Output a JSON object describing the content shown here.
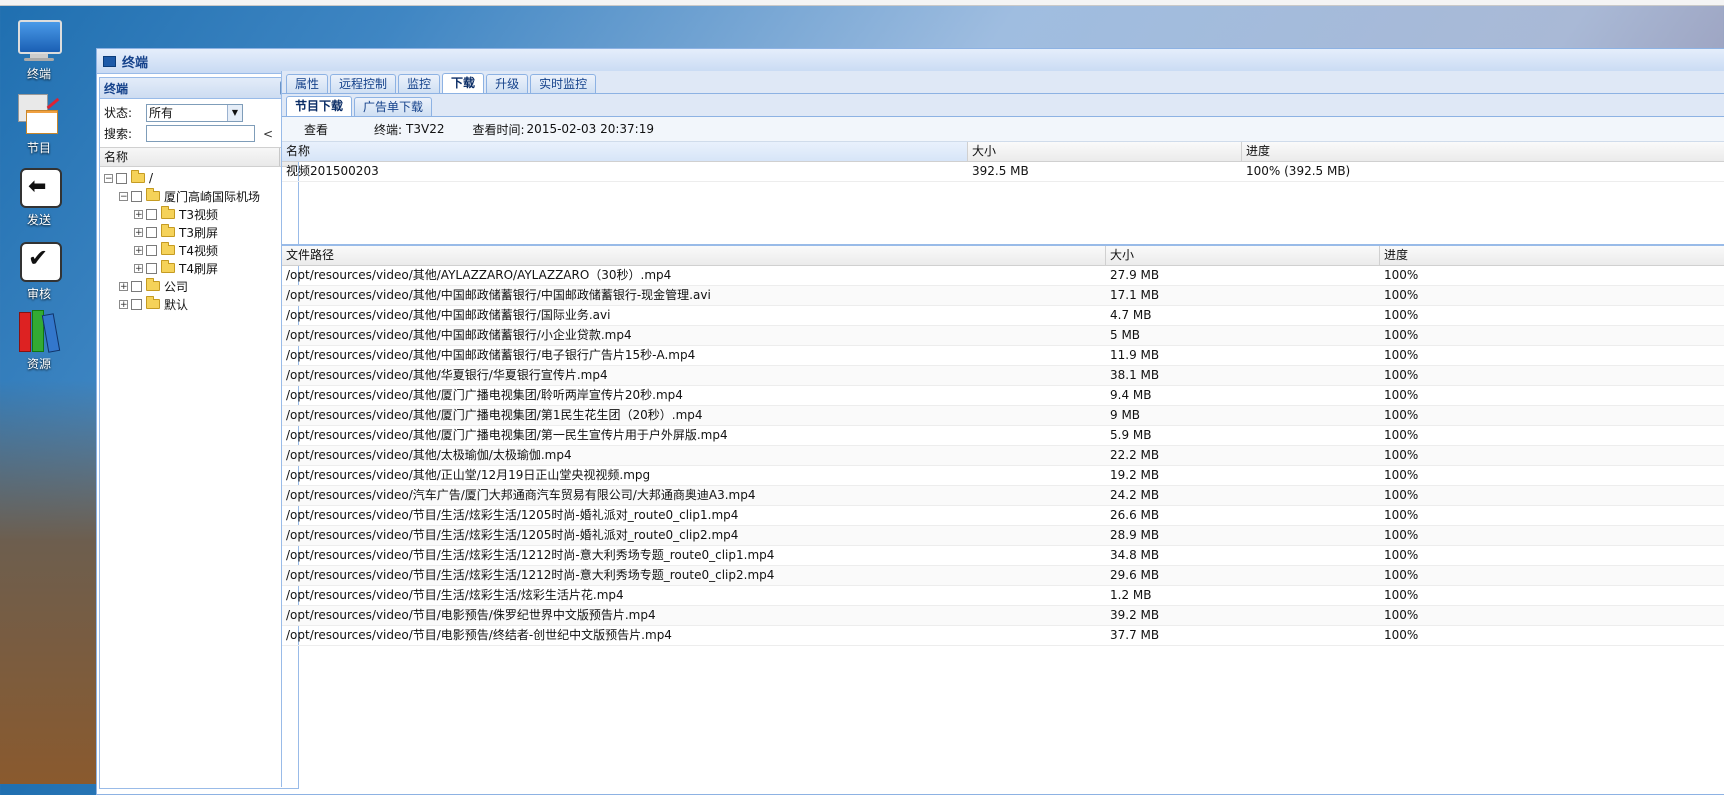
{
  "desktop": {
    "icons": [
      {
        "label": "终端"
      },
      {
        "label": "节目"
      },
      {
        "label": "发送"
      },
      {
        "label": "审核"
      },
      {
        "label": "资源"
      }
    ]
  },
  "window": {
    "title": "终端"
  },
  "left_panel": {
    "title": "终端",
    "status_label": "状态:",
    "status_value": "所有",
    "search_label": "搜索:",
    "search_value": "",
    "prev": "<",
    "next": ">",
    "tree_header": "名称",
    "tree": {
      "root": "/",
      "airport": "厦门高崎国际机场",
      "t3_video": "T3视频",
      "t3_flush": "T3刷屏",
      "t4_video": "T4视频",
      "t4_flush": "T4刷屏",
      "company": "公司",
      "default": "默认"
    }
  },
  "tabs": [
    "属性",
    "远程控制",
    "监控",
    "下载",
    "升级",
    "实时监控"
  ],
  "active_tab": "下载",
  "subtabs": [
    "节目下载",
    "广告单下载"
  ],
  "toolbar": {
    "view": "查看",
    "terminal_label": "终端:",
    "terminal_value": "T3V22",
    "time_label": "查看时间:",
    "time_value": "2015-02-03 20:37:19"
  },
  "top_grid": {
    "columns": [
      "名称",
      "大小",
      "进度"
    ],
    "rows": [
      [
        "视频201500203",
        "392.5 MB",
        "100% (392.5 MB)"
      ]
    ]
  },
  "bottom_grid": {
    "columns": [
      "文件路径",
      "大小",
      "进度"
    ],
    "rows": [
      [
        "/opt/resources/video/其他/AYLAZZARO/AYLAZZARO（30秒）.mp4",
        "27.9 MB",
        "100%"
      ],
      [
        "/opt/resources/video/其他/中国邮政储蓄银行/中国邮政储蓄银行-现金管理.avi",
        "17.1 MB",
        "100%"
      ],
      [
        "/opt/resources/video/其他/中国邮政储蓄银行/国际业务.avi",
        "4.7 MB",
        "100%"
      ],
      [
        "/opt/resources/video/其他/中国邮政储蓄银行/小企业贷款.mp4",
        "5 MB",
        "100%"
      ],
      [
        "/opt/resources/video/其他/中国邮政储蓄银行/电子银行广告片15秒-A.mp4",
        "11.9 MB",
        "100%"
      ],
      [
        "/opt/resources/video/其他/华夏银行/华夏银行宣传片.mp4",
        "38.1 MB",
        "100%"
      ],
      [
        "/opt/resources/video/其他/厦门广播电视集团/聆听两岸宣传片20秒.mp4",
        "9.4 MB",
        "100%"
      ],
      [
        "/opt/resources/video/其他/厦门广播电视集团/第1民生花生团（20秒）.mp4",
        "9 MB",
        "100%"
      ],
      [
        "/opt/resources/video/其他/厦门广播电视集团/第一民生宣传片用于户外屏版.mp4",
        "5.9 MB",
        "100%"
      ],
      [
        "/opt/resources/video/其他/太极瑜伽/太极瑜伽.mp4",
        "22.2 MB",
        "100%"
      ],
      [
        "/opt/resources/video/其他/正山堂/12月19日正山堂央视视频.mpg",
        "19.2 MB",
        "100%"
      ],
      [
        "/opt/resources/video/汽车广告/厦门大邦通商汽车贸易有限公司/大邦通商奥迪A3.mp4",
        "24.2 MB",
        "100%"
      ],
      [
        "/opt/resources/video/节目/生活/炫彩生活/1205时尚-婚礼派对_route0_clip1.mp4",
        "26.6 MB",
        "100%"
      ],
      [
        "/opt/resources/video/节目/生活/炫彩生活/1205时尚-婚礼派对_route0_clip2.mp4",
        "28.9 MB",
        "100%"
      ],
      [
        "/opt/resources/video/节目/生活/炫彩生活/1212时尚-意大利秀场专题_route0_clip1.mp4",
        "34.8 MB",
        "100%"
      ],
      [
        "/opt/resources/video/节目/生活/炫彩生活/1212时尚-意大利秀场专题_route0_clip2.mp4",
        "29.6 MB",
        "100%"
      ],
      [
        "/opt/resources/video/节目/生活/炫彩生活/炫彩生活片花.mp4",
        "1.2 MB",
        "100%"
      ],
      [
        "/opt/resources/video/节目/电影预告/侏罗纪世界中文版预告片.mp4",
        "39.2 MB",
        "100%"
      ],
      [
        "/opt/resources/video/节目/电影预告/终结者-创世纪中文版预告片.mp4",
        "37.7 MB",
        "100%"
      ]
    ]
  }
}
